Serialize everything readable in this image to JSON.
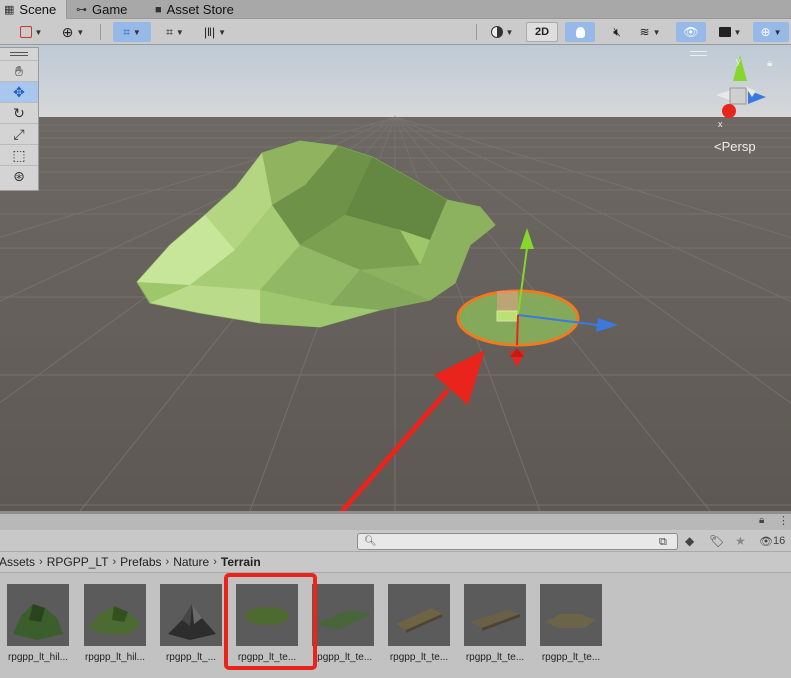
{
  "tabs": [
    {
      "label": "Scene",
      "icon": "grid-icon",
      "active": true
    },
    {
      "label": "Game",
      "icon": "gamepad-icon",
      "active": false
    },
    {
      "label": "Asset Store",
      "icon": "store-bag-icon",
      "active": false
    }
  ],
  "toolbar": {
    "mode_2d_label": "2D"
  },
  "scene": {
    "projection_label": "Persp",
    "gizmo_axes": [
      "y",
      "x",
      "z"
    ],
    "terrain_color": "#9ec66a",
    "selection_color": "#f07a1c",
    "arrow_color": "#e8241c"
  },
  "project": {
    "search": {
      "value": "",
      "placeholder": ""
    },
    "hidden_count": "16",
    "breadcrumb": [
      "Assets",
      "RPGPP_LT",
      "Prefabs",
      "Nature",
      "Terrain"
    ],
    "assets": [
      {
        "label": "rpgpp_lt_hil..."
      },
      {
        "label": "rpgpp_lt_hil..."
      },
      {
        "label": "rpgpp_lt_..."
      },
      {
        "label": "rpgpp_lt_te..."
      },
      {
        "label": "rpgpp_lt_te..."
      },
      {
        "label": "rpgpp_lt_te..."
      },
      {
        "label": "rpgpp_lt_te..."
      },
      {
        "label": "rpgpp_lt_te..."
      }
    ],
    "selected_index": 3
  }
}
